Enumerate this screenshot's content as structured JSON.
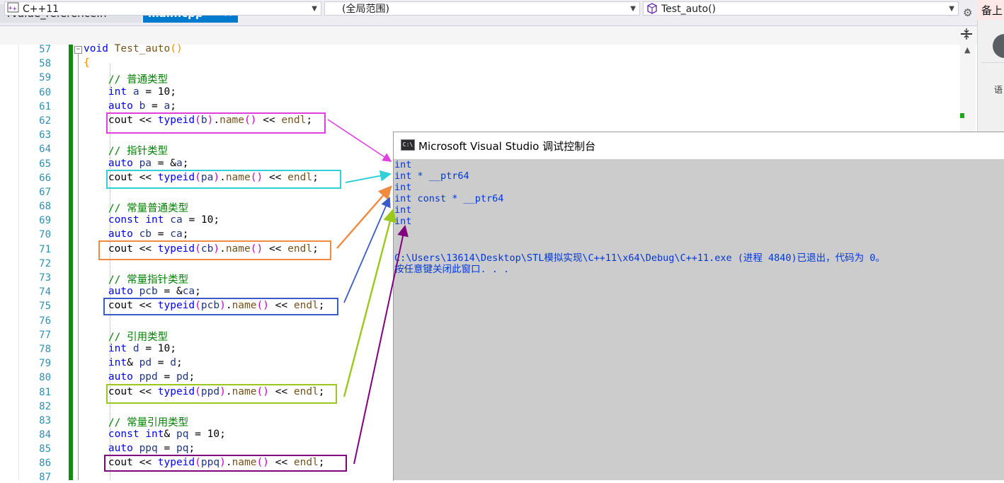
{
  "tabs": [
    {
      "label": "rvalue_reference.h",
      "active": false
    },
    {
      "label": "main.cpp",
      "active": true,
      "pin": "⊐",
      "close": "✕"
    }
  ],
  "tab_controls": {
    "dropdown": "▾",
    "gear": "⚙"
  },
  "navbar": {
    "project": "C++11",
    "scope": "(全局范围)",
    "function": "Test_auto()"
  },
  "right_panel": {
    "top_text": "备上",
    "lang_text": "语"
  },
  "code_lines": [
    {
      "n": "57"
    },
    {
      "n": "58"
    },
    {
      "n": "59"
    },
    {
      "n": "60"
    },
    {
      "n": "61"
    },
    {
      "n": "62"
    },
    {
      "n": "63"
    },
    {
      "n": "64"
    },
    {
      "n": "65"
    },
    {
      "n": "66"
    },
    {
      "n": "67"
    },
    {
      "n": "68"
    },
    {
      "n": "69"
    },
    {
      "n": "70"
    },
    {
      "n": "71"
    },
    {
      "n": "72"
    },
    {
      "n": "73"
    },
    {
      "n": "74"
    },
    {
      "n": "75"
    },
    {
      "n": "76"
    },
    {
      "n": "77"
    },
    {
      "n": "78"
    },
    {
      "n": "79"
    },
    {
      "n": "80"
    },
    {
      "n": "81"
    },
    {
      "n": "82"
    },
    {
      "n": "83"
    },
    {
      "n": "84"
    },
    {
      "n": "85"
    },
    {
      "n": "86"
    },
    {
      "n": "87"
    }
  ],
  "code": {
    "l57": {
      "kw": "void",
      "fn": "Test_auto",
      "paren": "()"
    },
    "l58": {
      "brace": "{"
    },
    "c59": "// 普通类型",
    "c64": "// 指针类型",
    "c68": "// 常量普通类型",
    "c73": "// 常量指针类型",
    "c77": "// 引用类型",
    "c83": "// 常量引用类型"
  },
  "highlight_colors": {
    "b": "#e040e0",
    "pa": "#30d0d8",
    "cb": "#f08a40",
    "pcb": "#3a5cc8",
    "ppd": "#9ac81c",
    "ppq": "#800080"
  },
  "console": {
    "title": "Microsoft Visual Studio 调试控制台",
    "icon": "C:\\",
    "output": [
      "int",
      "int * __ptr64",
      "int",
      "int const * __ptr64",
      "int",
      "int"
    ],
    "exit_line": "C:\\Users\\13614\\Desktop\\STL模拟实现\\C++11\\x64\\Debug\\C++11.exe (进程 4840)已退出，代码为 0。",
    "prompt_line": "按任意键关闭此窗口. . ."
  }
}
